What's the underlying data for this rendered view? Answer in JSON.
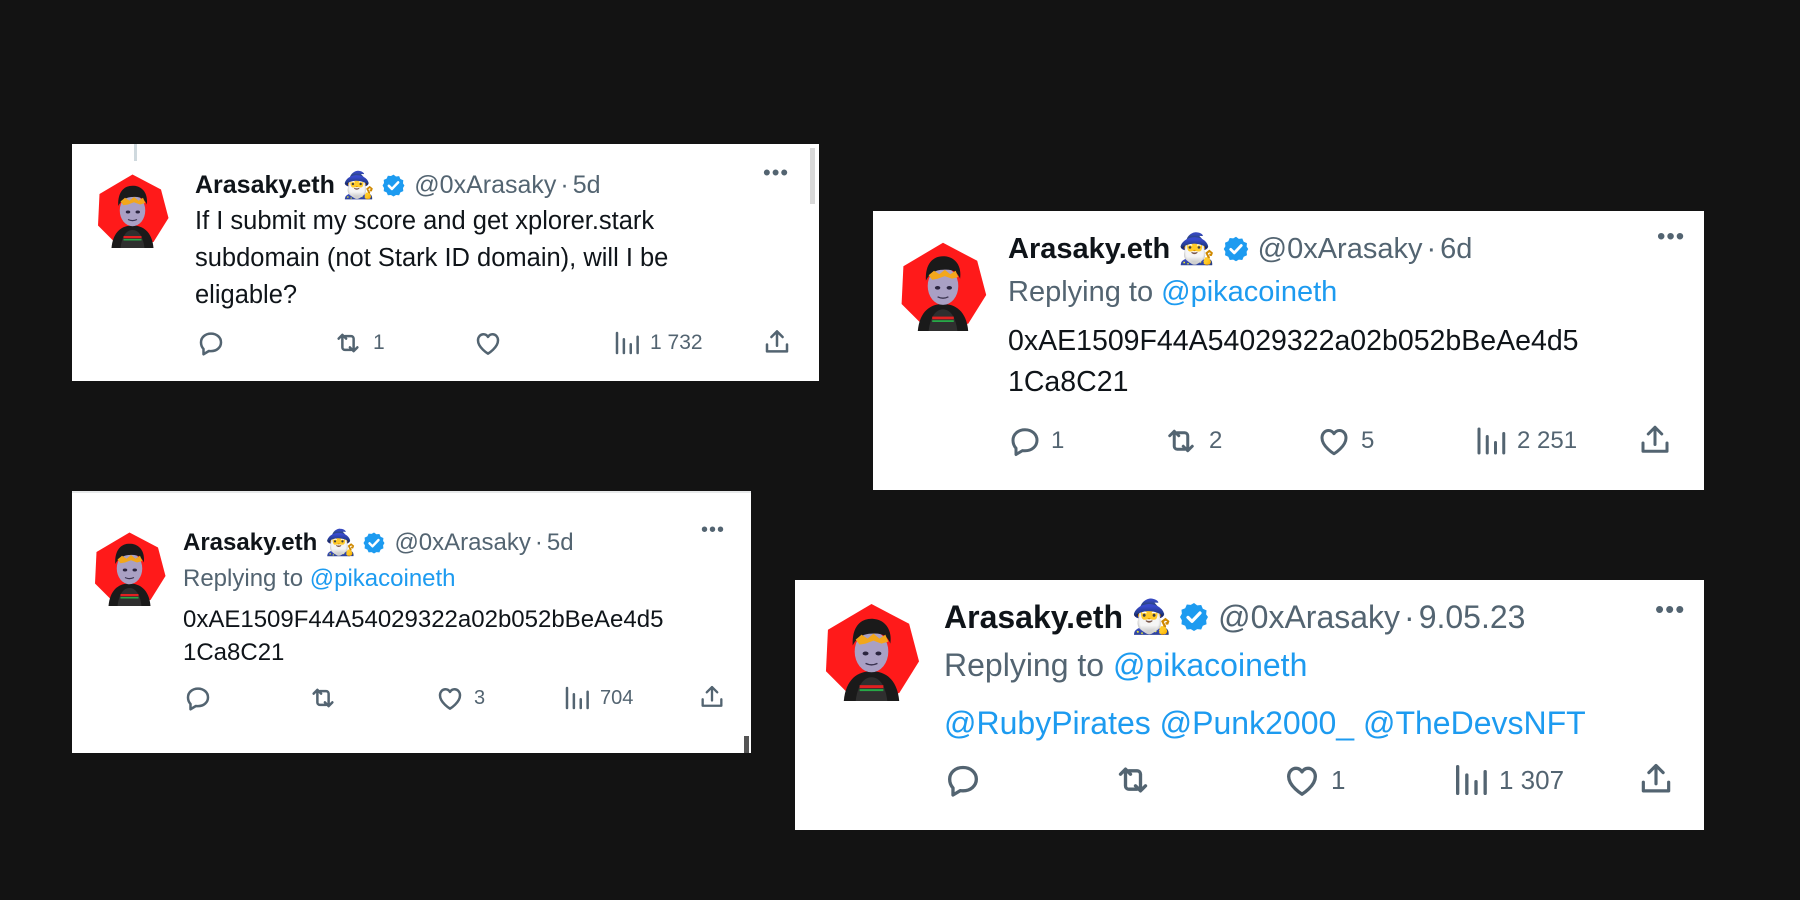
{
  "colors": {
    "background": "#131313",
    "card": "#ffffff",
    "accent": "#1d9bf0",
    "secondary_text": "#536471",
    "avatar_red": "#ff1a1a"
  },
  "tweets": [
    {
      "name": "Arasaky.eth",
      "emoji": "🧙‍♂️",
      "handle": "@0xArasaky",
      "dot": "·",
      "time": "5d",
      "replying_prefix": "",
      "replying_to": "",
      "text": "If I submit my score and get xplorer.stark subdomain (not Stark ID domain), will I be eligable?",
      "mentions": "",
      "reply_count": "",
      "retweet_count": "1",
      "like_count": "",
      "views": "1 732",
      "icons": [
        "reply-icon",
        "retweet-icon",
        "like-icon",
        "views-icon",
        "share-icon"
      ]
    },
    {
      "name": "Arasaky.eth",
      "emoji": "🧙‍♂️",
      "handle": "@0xArasaky",
      "dot": "·",
      "time": "6d",
      "replying_prefix": "Replying to ",
      "replying_to": "@pikacoineth",
      "text_line1": "0xAE1509F44A54029322a02b052bBeAe4d5",
      "text_line2": "1Ca8C21",
      "reply_count": "1",
      "retweet_count": "2",
      "like_count": "5",
      "views": "2 251"
    },
    {
      "name": "Arasaky.eth",
      "emoji": "🧙‍♂️",
      "handle": "@0xArasaky",
      "dot": "·",
      "time": "5d",
      "replying_prefix": "Replying to ",
      "replying_to": "@pikacoineth",
      "text_line1": "0xAE1509F44A54029322a02b052bBeAe4d5",
      "text_line2": "1Ca8C21",
      "reply_count": "",
      "retweet_count": "",
      "like_count": "3",
      "views": "704"
    },
    {
      "name": "Arasaky.eth",
      "emoji": "🧙‍♂️",
      "handle": "@0xArasaky",
      "dot": "·",
      "time": "9.05.23",
      "replying_prefix": "Replying to ",
      "replying_to": "@pikacoineth",
      "mentions": "@RubyPirates @Punk2000_ @TheDevsNFT",
      "reply_count": "",
      "retweet_count": "",
      "like_count": "1",
      "views": "1 307"
    }
  ]
}
